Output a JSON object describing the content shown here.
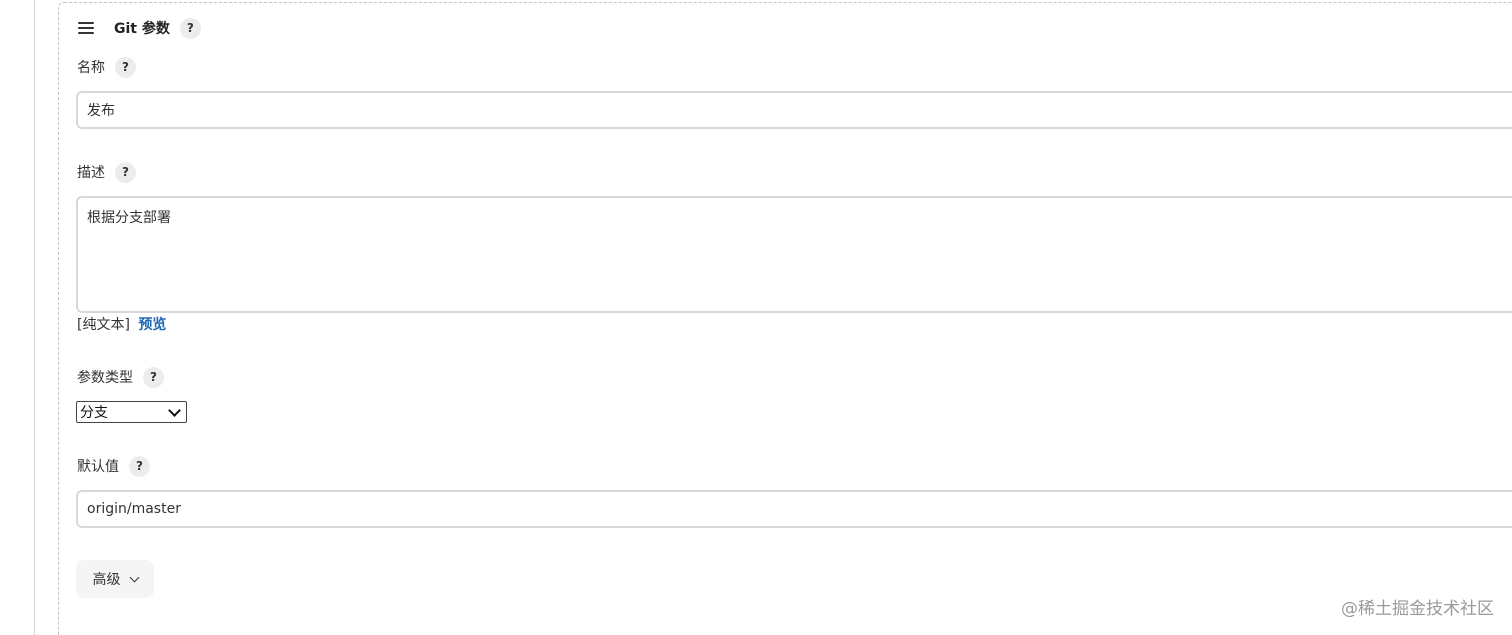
{
  "section": {
    "title": "Git 参数",
    "help": "?"
  },
  "fields": {
    "name": {
      "label": "名称",
      "help": "?",
      "value": "发布"
    },
    "description": {
      "label": "描述",
      "help": "?",
      "value": "根据分支部署",
      "format_label": "[纯文本]",
      "preview_link": "预览"
    },
    "param_type": {
      "label": "参数类型",
      "help": "?",
      "selected": "分支"
    },
    "default_value": {
      "label": "默认值",
      "help": "?",
      "value": "origin/master"
    }
  },
  "advanced_button": {
    "label": "高级"
  },
  "watermark": "@稀土掘金技术社区",
  "icons": {
    "drag": "drag-handle-icon",
    "help": "question-mark-icon",
    "select_arrow": "chevron-down-icon",
    "advanced_arrow": "chevron-down-icon"
  },
  "colors": {
    "link": "#1f68b5",
    "border": "#d8d8d8",
    "help_bg": "#ececec"
  }
}
